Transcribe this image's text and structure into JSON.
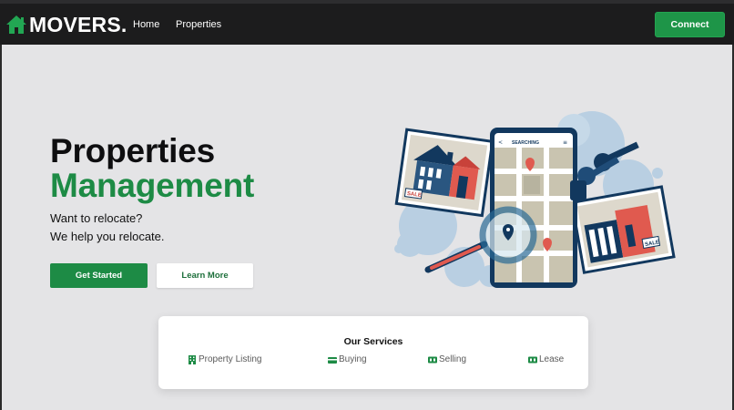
{
  "brand": {
    "name": "MOVERS.",
    "icon": "house-icon"
  },
  "nav": {
    "links": [
      {
        "label": "Home"
      },
      {
        "label": "Properties"
      }
    ],
    "connect_label": "Connect"
  },
  "hero": {
    "title_line1": "Properties",
    "title_line2": "Management",
    "subtitle_line1": "Want to relocate?",
    "subtitle_line2": "We help you relocate.",
    "primary_button": "Get Started",
    "secondary_button": "Learn More",
    "illustration": {
      "phone_header": "SEARCHING",
      "sale_sign_left": "SALE",
      "sale_sign_right": "SALE"
    }
  },
  "services": {
    "title": "Our Services",
    "items": [
      {
        "label": "Property Listing",
        "icon": "building-icon"
      },
      {
        "label": "Buying",
        "icon": "credit-card-icon"
      },
      {
        "label": "Selling",
        "icon": "ad-icon"
      },
      {
        "label": "Lease",
        "icon": "ad-icon"
      }
    ]
  },
  "colors": {
    "accent_green": "#1d8b45",
    "navbar_bg": "#1c1c1d",
    "page_bg": "#e4e4e6",
    "connect_green": "#1e9548"
  }
}
